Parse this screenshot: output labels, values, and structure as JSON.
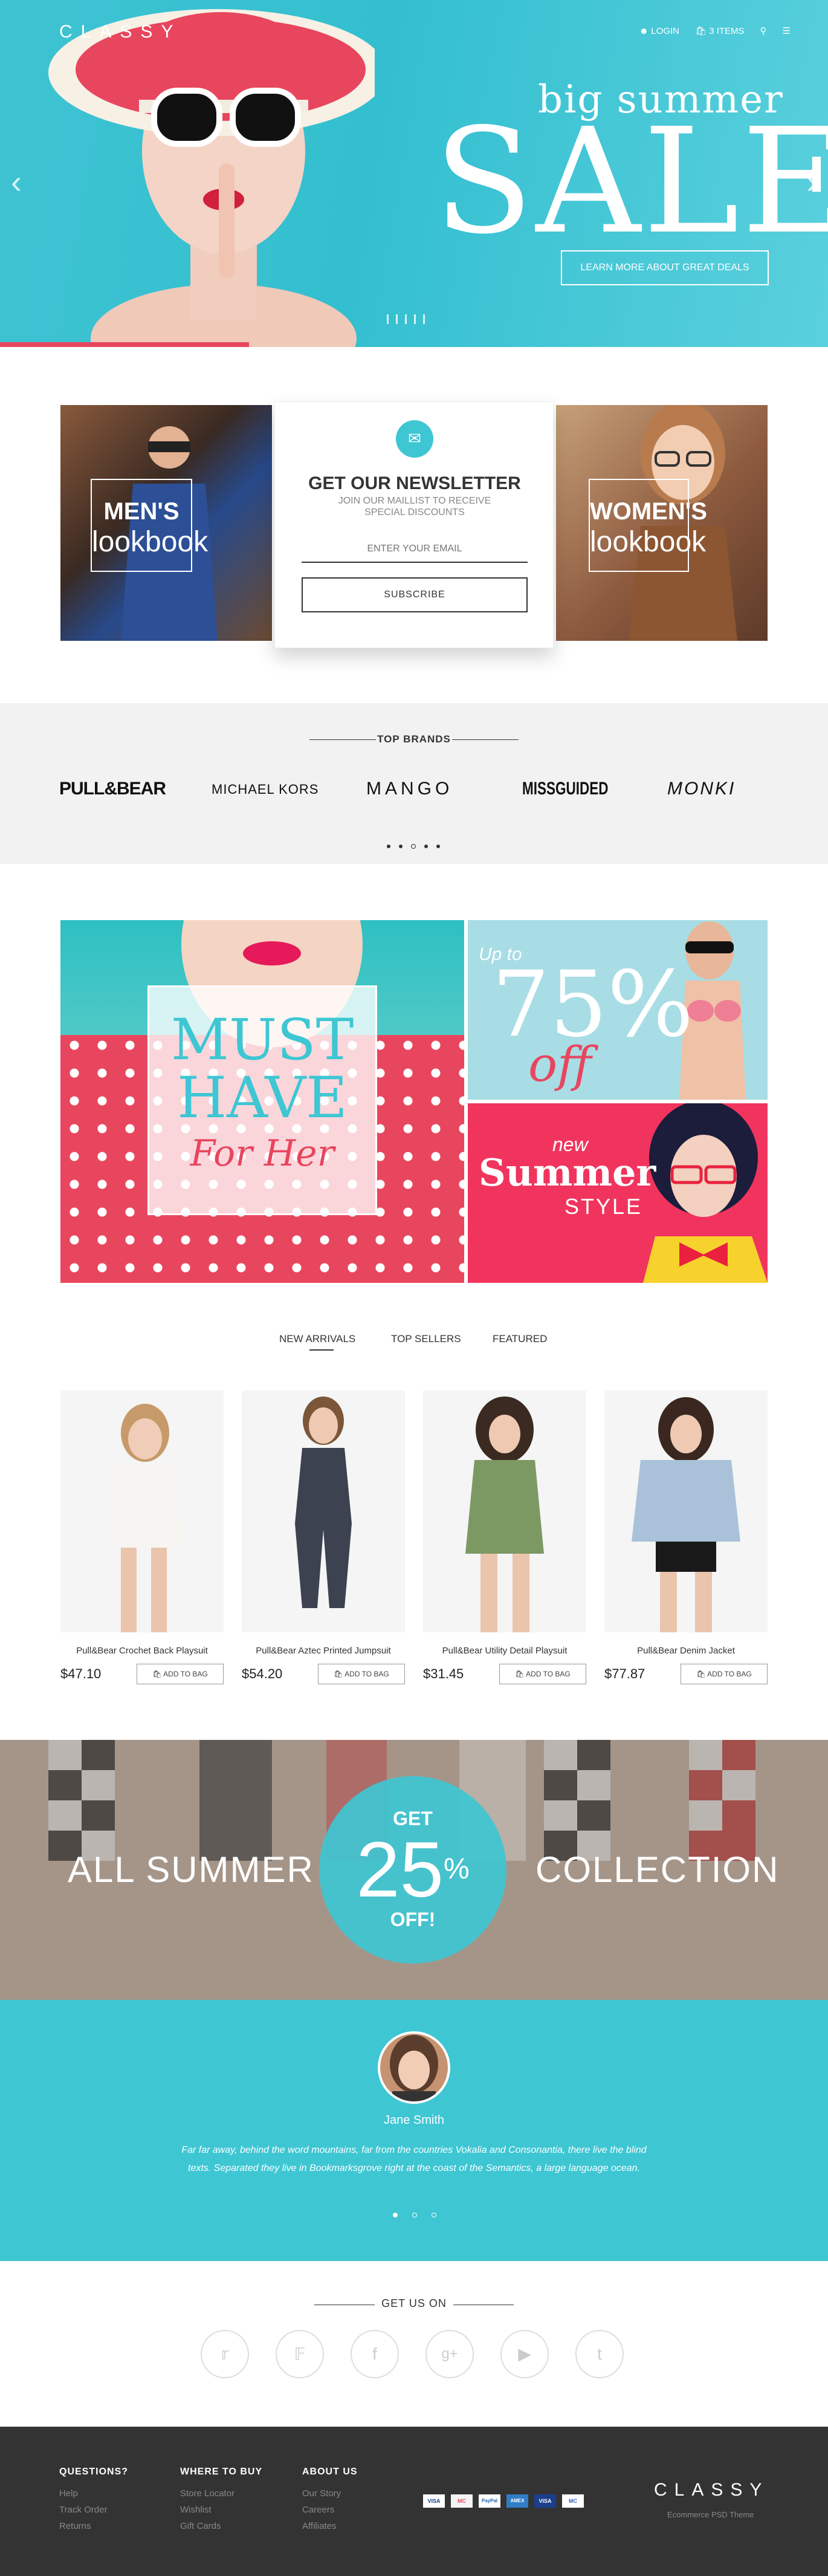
{
  "header": {
    "logo": "CLASSY",
    "login": "LOGIN",
    "cart": "3 ITEMS",
    "search_icon": "search-icon",
    "menu_icon": "menu-icon"
  },
  "hero": {
    "title_small": "big summer",
    "title_big": "SALE",
    "cta": "LEARN MORE ABOUT GREAT DEALS",
    "prev_icon": "chevron-left-icon",
    "next_icon": "chevron-right-icon"
  },
  "lookbooks": {
    "men_title": "MEN'S",
    "men_sub": "lookbook",
    "women_title": "WOMEN'S",
    "women_sub": "lookbook"
  },
  "newsletter": {
    "title": "GET OUR NEWSLETTER",
    "subtitle_line1": "JOIN OUR MAILLIST TO RECEIVE",
    "subtitle_line2": "SPECIAL DISCOUNTS",
    "email_placeholder": "ENTER YOUR EMAIL",
    "subscribe": "SUBSCRIBE"
  },
  "brands": {
    "heading": "TOP BRANDS",
    "items": [
      "PULL&BEAR",
      "MICHAEL KORS",
      "MANGO",
      "MISSGUIDED",
      "MONKI"
    ]
  },
  "promo": {
    "must": "MUST",
    "have": "HAVE",
    "for_her": "For Her",
    "up_to": "Up to",
    "percent": "75%",
    "off": "off",
    "new": "new",
    "summer": "Summer",
    "style": "STYLE"
  },
  "tabs": [
    "NEW ARRIVALS",
    "TOP SELLERS",
    "FEATURED"
  ],
  "products": [
    {
      "name": "Pull&Bear Crochet Back Playsuit",
      "price": "$47.10",
      "button": "ADD TO BAG"
    },
    {
      "name": "Pull&Bear Aztec Printed Jumpsuit",
      "price": "$54.20",
      "button": "ADD TO BAG"
    },
    {
      "name": "Pull&Bear Utility Detail Playsuit",
      "price": "$31.45",
      "button": "ADD TO BAG"
    },
    {
      "name": "Pull&Bear Denim Jacket",
      "price": "$77.87",
      "button": "ADD TO BAG"
    }
  ],
  "collection": {
    "left": "ALL SUMMER",
    "right": "COLLECTION",
    "get": "GET",
    "amount": "25",
    "percent": "%",
    "off": "OFF!"
  },
  "testimonial": {
    "name": "Jane Smith",
    "text": "Far far away, behind the word mountains, far from the countries Vokalia and Consonantia, there live the blind texts. Separated they live in Bookmarksgrove right at the coast of the Semantics, a large language ocean."
  },
  "social": {
    "heading": "GET US ON",
    "icons": [
      "twitter-icon",
      "pinterest-icon",
      "facebook-icon",
      "google-plus-icon",
      "youtube-icon",
      "tumblr-icon"
    ]
  },
  "footer": {
    "col1": {
      "title": "QUESTIONS?",
      "links": [
        "Help",
        "Track Order",
        "Returns"
      ]
    },
    "col2": {
      "title": "WHERE TO BUY",
      "links": [
        "Store Locator",
        "Wishlist",
        "Gift Cards"
      ]
    },
    "col3": {
      "title": "ABOUT US",
      "links": [
        "Our Story",
        "Careers",
        "Affiliates"
      ]
    },
    "payments": [
      "VISA",
      "MC",
      "PayPal",
      "AMEX",
      "VISA",
      "MC"
    ],
    "logo": "CLASSY",
    "tagline": "Ecommerce PSD Theme"
  },
  "colors": {
    "accent": "#3ec6d3",
    "pink": "#e8465e",
    "footer_bg": "#333333"
  }
}
